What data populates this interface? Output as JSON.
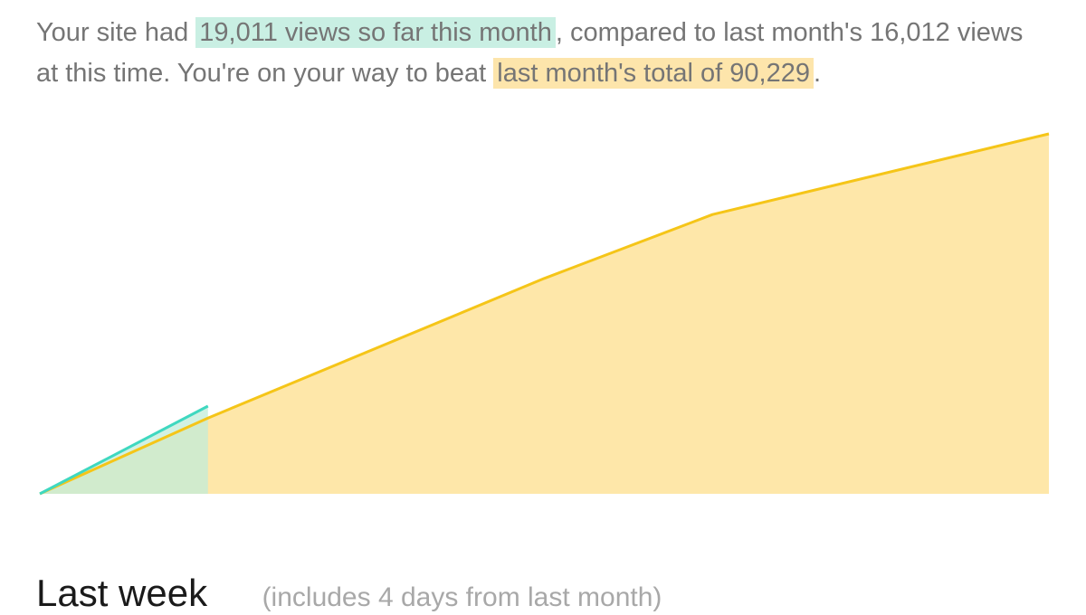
{
  "summary": {
    "intro": "Your site had ",
    "current_views_highlight": "19,011 views so far this month",
    "middle": ", compared to last month's 16,012 views at this time. You're on your way to beat ",
    "last_month_highlight": "last month's total of 90,229",
    "end": "."
  },
  "colors": {
    "current_line": "#3fd8c0",
    "current_fill": "#c2ecd9",
    "overlap_fill": "#bfe6b3",
    "previous_line": "#f5c518",
    "previous_fill": "#fee7a9",
    "text": "#757575",
    "current_highlight": "#c9efe3",
    "previous_highlight": "#fde5ab"
  },
  "chart_data": {
    "type": "area",
    "title": "",
    "xlabel": "",
    "ylabel": "",
    "xlim": [
      0,
      30
    ],
    "ylim": [
      0,
      90229
    ],
    "axes_visible": false,
    "grid": false,
    "legend": "none",
    "series": [
      {
        "x": [
          0,
          5,
          15,
          20,
          30
        ],
        "values": [
          0,
          19000,
          54000,
          70000,
          90229
        ]
      },
      {
        "x": [
          0,
          5
        ],
        "values": [
          0,
          22000
        ]
      }
    ]
  },
  "section": {
    "title": "Last week",
    "note": "(includes 4 days from last month)"
  }
}
